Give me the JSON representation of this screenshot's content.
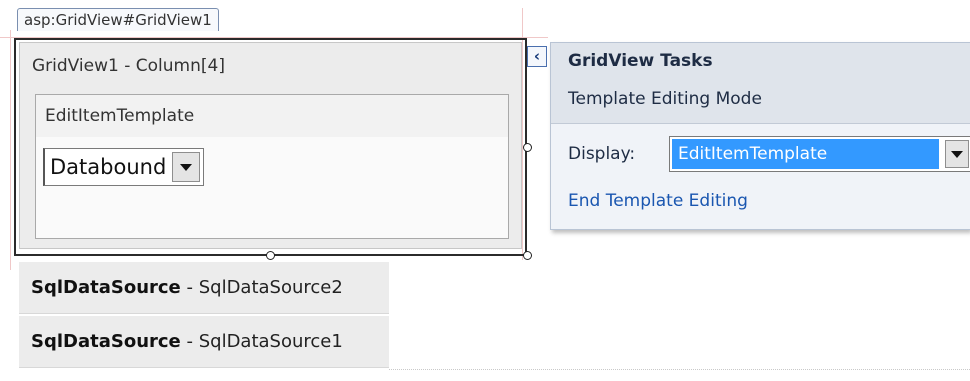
{
  "tag_label": "asp:GridView#GridView1",
  "grid_panel": {
    "header": "GridView1 - Column[4]",
    "template_header": "EditItemTemplate",
    "dropdown_value": "Databound"
  },
  "tasks": {
    "title": "GridView Tasks",
    "subtitle": "Template Editing Mode",
    "display_label": "Display:",
    "display_value": "EditItemTemplate",
    "end_link": "End Template Editing"
  },
  "data_sources": [
    {
      "type": "SqlDataSource",
      "separator": " - ",
      "id": "SqlDataSource2"
    },
    {
      "type": "SqlDataSource",
      "separator": " - ",
      "id": "SqlDataSource1"
    }
  ],
  "colors": {
    "selection_highlight": "#3399ff",
    "link": "#1a56b0",
    "tasks_header_bg": "#dfe4eb"
  },
  "icons": {
    "collapse": "chevron-left-icon",
    "dropdown": "chevron-down-icon"
  }
}
